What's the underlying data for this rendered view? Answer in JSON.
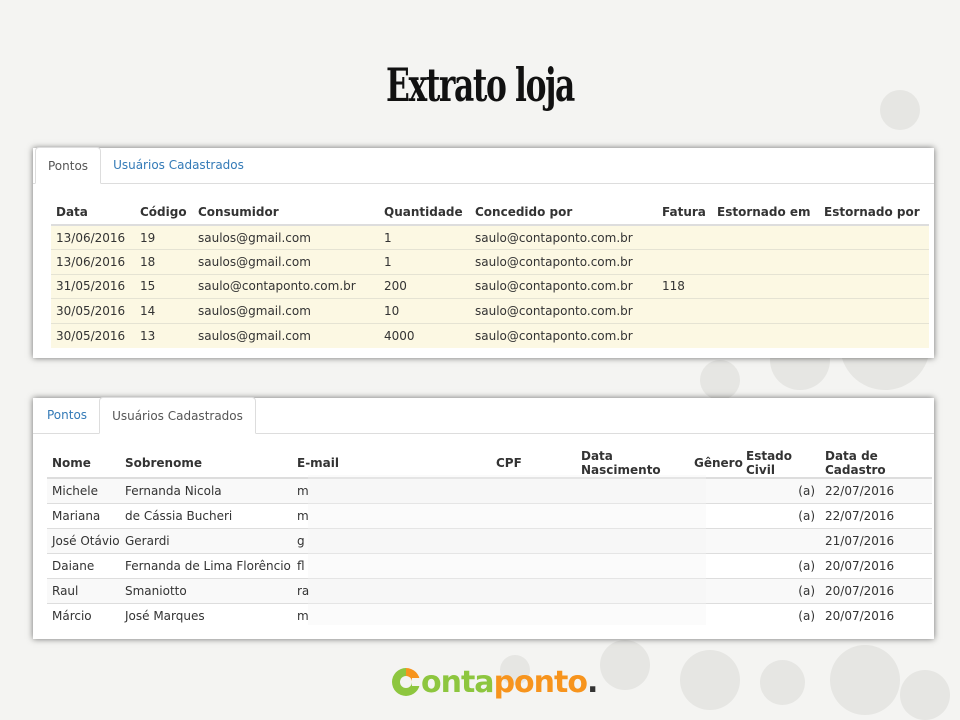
{
  "title": "Extrato loja",
  "panel1": {
    "tabs": [
      "Pontos",
      "Usuários Cadastrados"
    ],
    "active_tab": "Pontos",
    "columns": [
      "Data",
      "Código",
      "Consumidor",
      "Quantidade",
      "Concedido por",
      "Fatura",
      "Estornado em",
      "Estornado por"
    ],
    "rows": [
      [
        "13/06/2016",
        "19",
        "saulos@gmail.com",
        "1",
        "saulo@contaponto.com.br",
        "",
        "",
        ""
      ],
      [
        "13/06/2016",
        "18",
        "saulos@gmail.com",
        "1",
        "saulo@contaponto.com.br",
        "",
        "",
        ""
      ],
      [
        "31/05/2016",
        "15",
        "saulo@contaponto.com.br",
        "200",
        "saulo@contaponto.com.br",
        "118",
        "",
        ""
      ],
      [
        "30/05/2016",
        "14",
        "saulos@gmail.com",
        "10",
        "saulo@contaponto.com.br",
        "",
        "",
        ""
      ],
      [
        "30/05/2016",
        "13",
        "saulos@gmail.com",
        "4000",
        "saulo@contaponto.com.br",
        "",
        "",
        ""
      ]
    ]
  },
  "panel2": {
    "tabs": [
      "Pontos",
      "Usuários Cadastrados"
    ],
    "active_tab": "Usuários Cadastrados",
    "columns": [
      "Nome",
      "Sobrenome",
      "E-mail",
      "CPF",
      "Data Nascimento",
      "Gênero",
      "Estado Civil",
      "Data de Cadastro"
    ],
    "rows": [
      [
        "Michele",
        "Fernanda Nicola",
        "m",
        "",
        "",
        "",
        "(a)",
        "22/07/2016"
      ],
      [
        "Mariana",
        "de Cássia Bucheri",
        "m",
        "",
        "",
        "",
        "(a)",
        "22/07/2016"
      ],
      [
        "José Otávio",
        "Gerardi",
        "g",
        "",
        "",
        "",
        "",
        "21/07/2016"
      ],
      [
        "Daiane",
        "Fernanda de Lima Florêncio",
        "fl",
        "",
        "",
        "",
        "(a)",
        "20/07/2016"
      ],
      [
        "Raul",
        "Smaniotto",
        "ra",
        "",
        "",
        "",
        "(a)",
        "20/07/2016"
      ],
      [
        "Márcio",
        "José Marques",
        "m",
        "",
        "",
        "",
        "(a)",
        "20/07/2016"
      ]
    ]
  },
  "logo": {
    "part1": "ontaponto",
    "dot": ".",
    "colors": {
      "green": "#8dc63f",
      "orange": "#f7941d"
    }
  }
}
